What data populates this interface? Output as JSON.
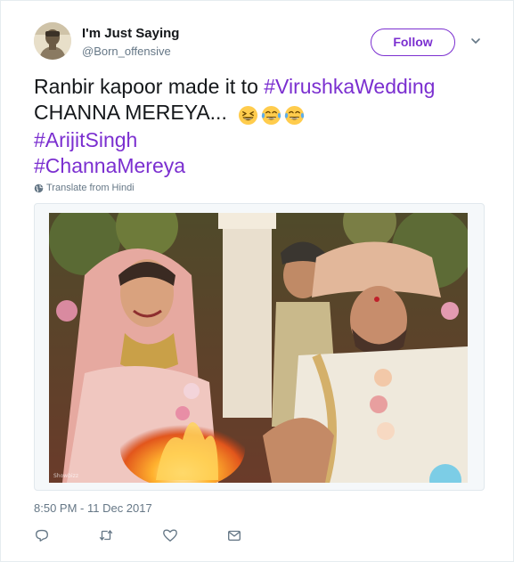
{
  "user": {
    "display_name": "I'm Just Saying",
    "handle": "@Born_offensive",
    "avatar": "user-avatar"
  },
  "follow_button": {
    "label": "Follow"
  },
  "more_menu": {
    "icon": "chevron-down-icon"
  },
  "tweet": {
    "line1_text": "Ranbir kapoor made it to ",
    "line1_hashtag": "#VirushkaWedding",
    "line2_text": "CHANNA MEREYA... ",
    "emojis": [
      "grinning-squinting-face",
      "face-with-tears-of-joy",
      "face-with-tears-of-joy"
    ],
    "hashtags": [
      "#ArijitSingh",
      "#ChannaMereya"
    ]
  },
  "translate": {
    "label": "Translate from Hindi",
    "icon": "globe-icon"
  },
  "media": {
    "description_icon": "wedding-photo",
    "watermark": "Showbizz"
  },
  "timestamp": "8:50 PM - 11 Dec 2017",
  "actions": {
    "reply": "reply-icon",
    "retweet": "retweet-icon",
    "like": "heart-icon",
    "message": "message-icon"
  },
  "colors": {
    "accent": "#7b2fd0",
    "text": "#14171a",
    "muted": "#657786",
    "border": "#e6ecf0"
  }
}
